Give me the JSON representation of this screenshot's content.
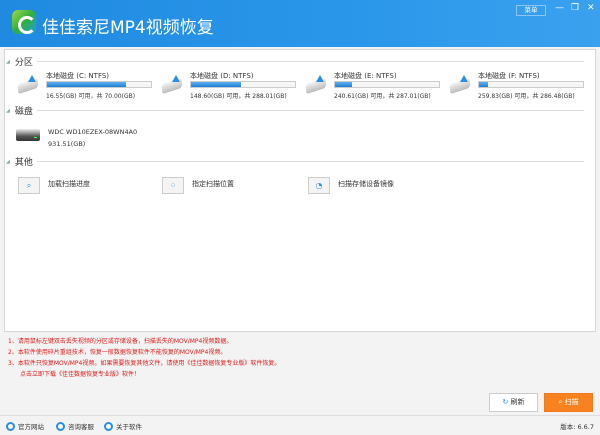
{
  "app": {
    "title": "佳佳索尼MP4视频恢复",
    "menu_label": "菜单",
    "minimize": "—",
    "maximize": "❐",
    "close": "✕"
  },
  "sections": {
    "partitions": "分区",
    "disks": "磁盘",
    "other": "其他"
  },
  "partitions": [
    {
      "name": "本地磁盘 (C: NTFS)",
      "info": "16.55(GB) 可用，共 70.00(GB)",
      "used_percent": 76
    },
    {
      "name": "本地磁盘 (D: NTFS)",
      "info": "148.60(GB) 可用，共 288.01(GB)",
      "used_percent": 48
    },
    {
      "name": "本地磁盘 (E: NTFS)",
      "info": "240.61(GB) 可用，共 287.01(GB)",
      "used_percent": 16
    },
    {
      "name": "本地磁盘 (F: NTFS)",
      "info": "259.83(GB) 可用，共 286.48(GB)",
      "used_percent": 9
    }
  ],
  "disk": {
    "name": "WDC WD10EZEX-08WN4A0",
    "size": "931.51(GB)"
  },
  "other": [
    {
      "label": "加载扫描进度"
    },
    {
      "label": "指定扫描位置"
    },
    {
      "label": "扫描存储设备镜像"
    }
  ],
  "notes": [
    "1、请用鼠标左键双击丢失视频的分区或存储设备，扫描丢失的MOV/MP4视频数据。",
    "2、本软件使用碎片重组技术，恢复一般数据恢复软件不能恢复的MOV/MP4视频。",
    "3、本软件只恢复MOV/MP4视频。如果需要恢复其他文件，请使用《佳佳数据恢复专业版》软件恢复。",
    "点击立即下载《佳佳数据恢复专业版》软件！"
  ],
  "buttons": {
    "refresh": "刷新",
    "scan": "扫描"
  },
  "footer": {
    "website": "官方网站",
    "support": "咨询客服",
    "about": "关于软件",
    "version": "版本: 6.6.7"
  }
}
